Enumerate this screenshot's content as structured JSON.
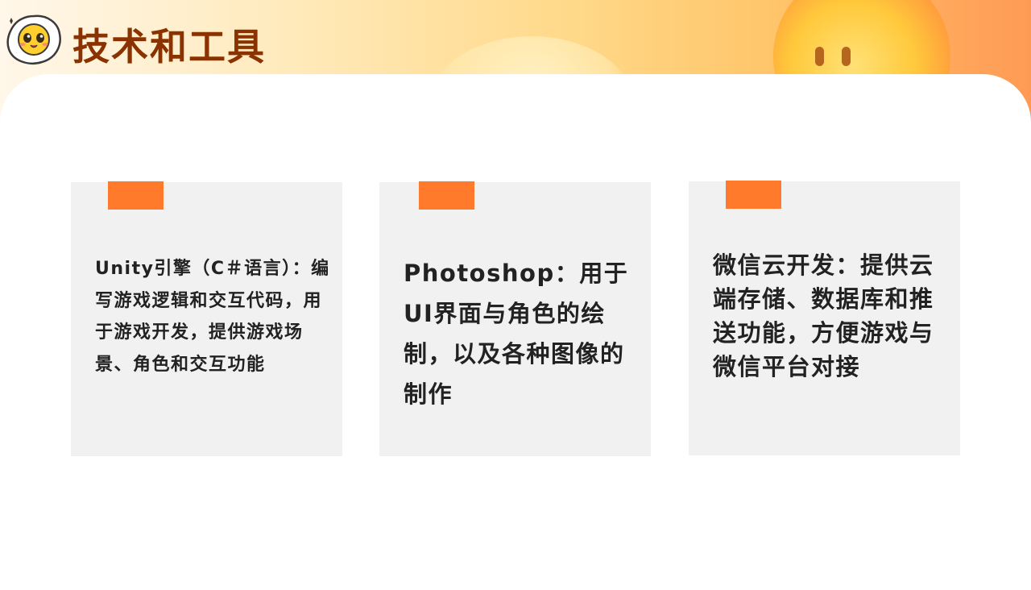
{
  "header": {
    "title": "技术和工具"
  },
  "cards": [
    {
      "text": "Unity引擎（C＃语言）：编写游戏逻辑和交互代码，用于游戏开发，提供游戏场景、角色和交互功能"
    },
    {
      "text": "Photoshop：用于UI界面与角色的绘制，以及各种图像的制作"
    },
    {
      "text": "微信云开发：提供云端存储、数据库和推送功能，方便游戏与微信平台对接"
    }
  ],
  "colors": {
    "accent": "#ff7a2a",
    "title": "#8a3300",
    "card_bg": "#f1f1f1",
    "text": "#222222"
  },
  "icons": {
    "mascot": "cute-egg-mascot-icon",
    "sun": "smiling-sun-decoration"
  }
}
